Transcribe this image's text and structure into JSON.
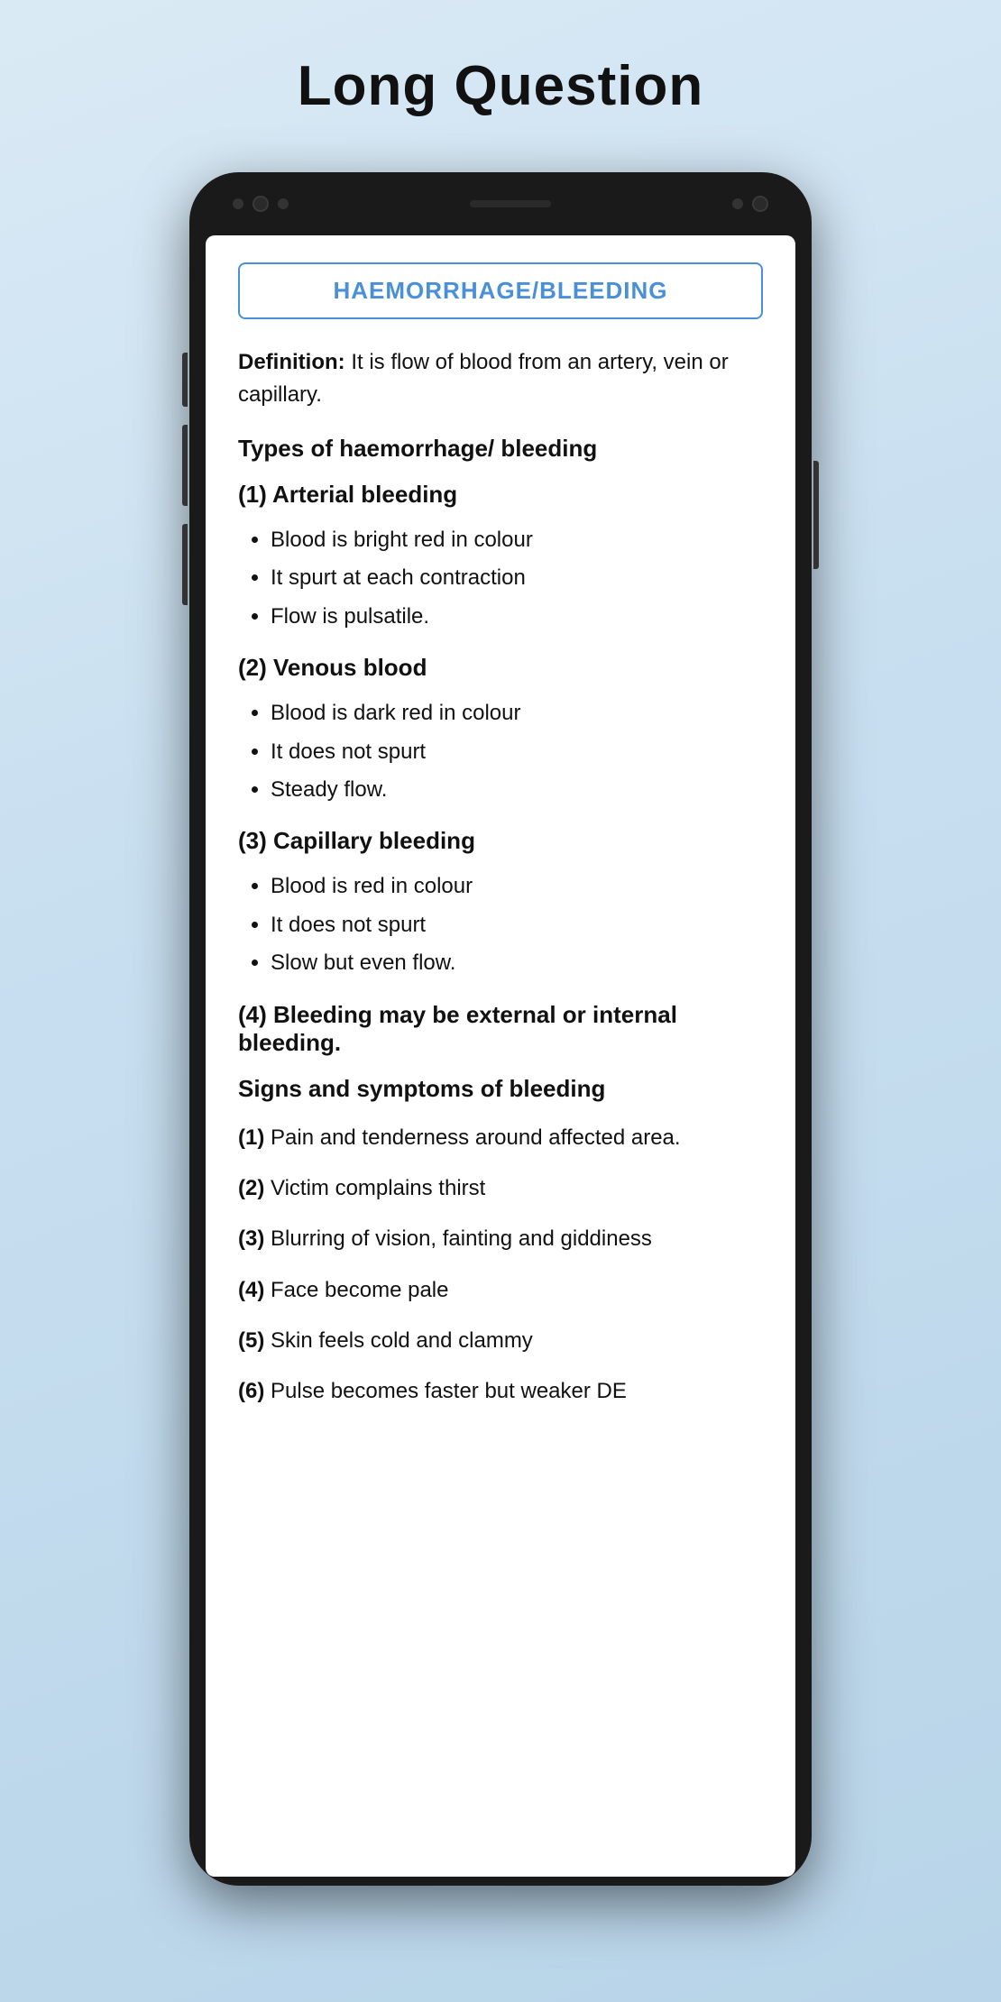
{
  "page": {
    "title": "Long Question"
  },
  "content": {
    "topic_header": "HAEMORRHAGE/BLEEDING",
    "definition_label": "Definition:",
    "definition_text": " It is flow of blood from an artery, vein or capillary.",
    "types_heading": "Types of haemorrhage/ bleeding",
    "arterial": {
      "heading": "(1) Arterial bleeding",
      "bullets": [
        "Blood is bright red in colour",
        "It spurt at each contraction",
        "Flow is pulsatile."
      ]
    },
    "venous": {
      "heading": "(2) Venous blood",
      "bullets": [
        "Blood is dark red in colour",
        "It does not spurt",
        "Steady flow."
      ]
    },
    "capillary": {
      "heading": "(3) Capillary bleeding",
      "bullets": [
        "Blood is red in colour",
        "It does not spurt",
        "Slow but even flow."
      ]
    },
    "external_internal": "(4) Bleeding may be external or internal bleeding.",
    "signs_heading": "Signs and symptoms of bleeding",
    "signs": [
      {
        "num": "(1)",
        "text": "Pain and tenderness around affected area."
      },
      {
        "num": "(2)",
        "text": "Victim complains thirst"
      },
      {
        "num": "(3)",
        "text": "Blurring of vision, fainting and giddiness"
      },
      {
        "num": "(4)",
        "text": "Face become pale"
      },
      {
        "num": "(5)",
        "text": "Skin feels cold and clammy"
      },
      {
        "num": "(6)",
        "text": "Pulse becomes faster but weaker DE"
      }
    ]
  }
}
